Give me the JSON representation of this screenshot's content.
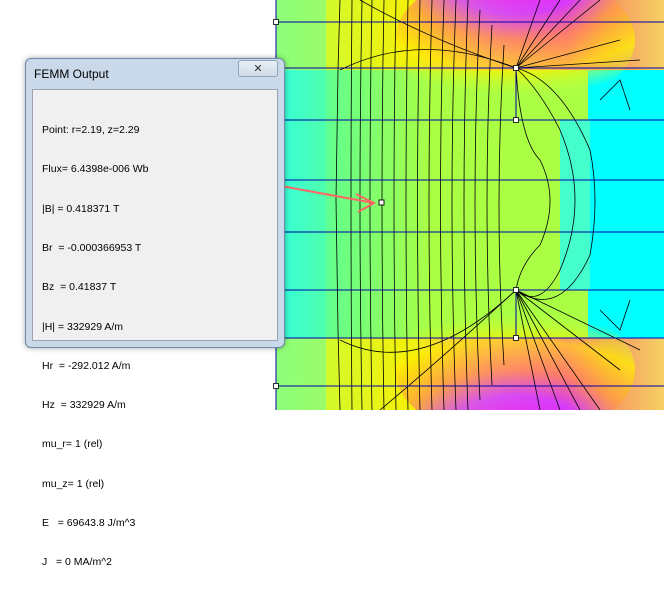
{
  "window": {
    "title": "FEMM Output",
    "close_glyph": "✕",
    "lines": [
      "Point: r=2.19, z=2.29",
      "Flux= 6.4398e-006 Wb",
      "|B| = 0.418371 T",
      "Br  = -0.000366953 T",
      "Bz  = 0.41837 T",
      "|H| = 332929 A/m",
      "Hr  = -292.012 A/m",
      "Hz  = 332929 A/m",
      "mu_r= 1 (rel)",
      "mu_z= 1 (rel)",
      "E   = 69643.8 J/m^3",
      "J   = 0 MA/m^2"
    ]
  },
  "plot": {
    "colors": {
      "cyan": "#00ffff",
      "light_cyan": "#33ffee",
      "green": "#aaff44",
      "yellow_green": "#ccff33",
      "yellow": "#ffee00",
      "magenta": "#ff00ff",
      "purple": "#cc44ff",
      "orange": "#ff9900",
      "boundary_blue": "#0000aa",
      "contour": "#000000",
      "arrow": "#ff6666"
    }
  }
}
